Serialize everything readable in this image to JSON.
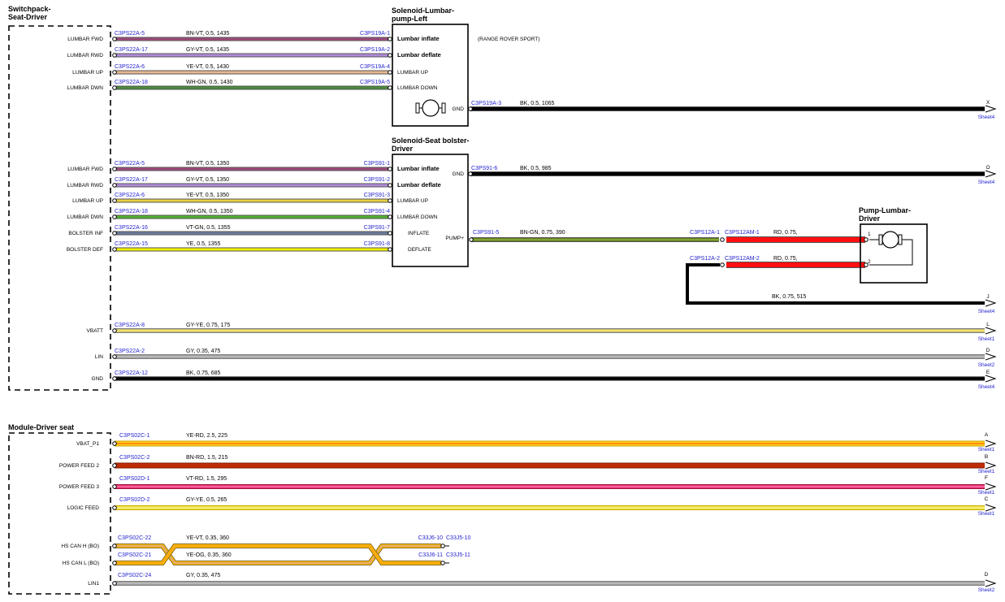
{
  "components": {
    "switchpack": {
      "title_line1": "Switchpack-",
      "title_line2": "Seat-Driver",
      "pins": [
        "LUMBAR FWD",
        "LUMBAR RWD",
        "LUMBAR UP",
        "LUMBAR DWN",
        "LUMBAR FWD",
        "LUMBAR RWD",
        "LUMBAR UP",
        "LUMBAR DWN",
        "BOLSTER INF",
        "BOLSTER DEF",
        "VBATT",
        "LIN",
        "GND"
      ]
    },
    "solenoid_lumbar": {
      "title_line1": "Solenoid-Lumbar-",
      "title_line2": "pump-Left",
      "pins": [
        "Lumbar inflate",
        "Lumbar deflate",
        "LUMBAR UP",
        "LUMBAR DOWN"
      ],
      "gnd": "GND",
      "note": "(RANGE ROVER SPORT)"
    },
    "solenoid_bolster": {
      "title_line1": "Solenoid-Seat bolster-",
      "title_line2": "Driver",
      "pins": [
        "Lumbar inflate",
        "Lumbar deflate",
        "LUMBAR UP",
        "LUMBAR DOWN",
        "INFLATE",
        "DEFLATE"
      ],
      "gnd": "GND",
      "pump": "PUMP+"
    },
    "pump": {
      "title_line1": "Pump-Lumbar-",
      "title_line2": "Driver",
      "pin1": "1",
      "pin2": "2"
    },
    "module": {
      "title": "Module-Driver seat",
      "pins": [
        "VBAT_P1",
        "POWER FEED 2",
        "POWER FEED 3",
        "LOGIC FEED",
        "HS CAN H (BO)",
        "HS CAN L (BO)",
        "LIN1"
      ]
    }
  },
  "wires": [
    {
      "from": "C3PS22A-5",
      "to": "C3PS19A-1",
      "label": "BN-VT,  0.5,  1435",
      "color": "#9c4a7a"
    },
    {
      "from": "C3PS22A-17",
      "to": "C3PS19A-2",
      "label": "GY-VT,  0.5,  1435",
      "color": "#b08ad8"
    },
    {
      "from": "C3PS22A-6",
      "to": "C3PS19A-4",
      "label": "YE-VT,  0.5,  1430",
      "color": "#e8b890"
    },
    {
      "from": "C3PS22A-18",
      "to": "C3PS19A-5",
      "label": "WH-GN,  0.5,  1430",
      "color": "#4a8a3a"
    },
    {
      "from": "C3PS22A-5",
      "to": "C3PS91-1",
      "label": "BN-VT,  0.5,  1350",
      "color": "#9c4a7a"
    },
    {
      "from": "C3PS22A-17",
      "to": "C3PS91-2",
      "label": "GY-VT,  0.5,  1350",
      "color": "#b08ad8"
    },
    {
      "from": "C3PS22A-6",
      "to": "C3PS91-3",
      "label": "YE-VT,  0.5,  1350",
      "color": "#e8d040"
    },
    {
      "from": "C3PS22A-18",
      "to": "C3PS91-4",
      "label": "WH-GN,  0.5,  1350",
      "color": "#50b030"
    },
    {
      "from": "C3PS22A-16",
      "to": "C3PS91-7",
      "label": "VT-GN,  0.5,  1355",
      "color": "#6a7a9a"
    },
    {
      "from": "C3PS22A-15",
      "to": "C3PS91-8",
      "label": "YE,  0.5,  1355",
      "color": "#f0f000"
    },
    {
      "from": "C3PS22A-8",
      "to": "",
      "label": "GY-YE,  0.75,  175",
      "color": "#eee070",
      "dest": "L",
      "sheet": "Sheet1"
    },
    {
      "from": "C3PS22A-2",
      "to": "",
      "label": "GY,  0.35,  475",
      "color": "#b8b8b8",
      "dest": "D",
      "sheet": "Sheet2"
    },
    {
      "from": "C3PS22A-12",
      "to": "",
      "label": "BK,  0.75,  685",
      "color": "#000000",
      "dest": "E",
      "sheet": "Sheet4"
    }
  ],
  "gnd_wires": [
    {
      "from": "C3PS19A-3",
      "label": "BK,  0.5,  1065",
      "dest": "X",
      "sheet": "Sheet4"
    },
    {
      "from": "C3PS91-6",
      "label": "BK,  0.5,  985",
      "dest": "O",
      "sheet": "Sheet4"
    }
  ],
  "pump_wires": {
    "pos_from": "C3PS91-5",
    "pos_label": "BN-GN,  0.75,  390",
    "c1a": "C3PS12A-1",
    "c1b": "C3PS12AM-1",
    "c1_label": "RD,  0.75,",
    "c2a": "C3PS12A-2",
    "c2b": "C3PS12AM-2",
    "c2_label": "RD,  0.75,",
    "gnd_label": "BK,  0.75,  515",
    "gnd_dest": "J",
    "gnd_sheet": "Sheet4"
  },
  "module_wires": [
    {
      "from": "C3PS02C-1",
      "label": "YE-RD,  2.5,  225",
      "dest": "A",
      "sheet": "Sheet1"
    },
    {
      "from": "C3PS02C-2",
      "label": "BN-RD,  1.5,  215",
      "dest": "B",
      "sheet": "Sheet1"
    },
    {
      "from": "C3PS02D-1",
      "label": "VT-RD,  1.5,  295",
      "dest": "F",
      "sheet": "Sheet1"
    },
    {
      "from": "C3PS02D-2",
      "label": "GY-YE,  0.5,  265",
      "dest": "C",
      "sheet": "Sheet1"
    }
  ],
  "can": {
    "h_from": "C3PS02C-22",
    "h_label": "YE-VT,  0.35,  360",
    "h_to1": "C33J6-10",
    "h_to2": "C33J5-10",
    "l_from": "C3PS02C-21",
    "l_label": "YE-OG,  0.35,  360",
    "l_to1": "C33J6-11",
    "l_to2": "C33J5-11"
  },
  "lin1": {
    "from": "C3PS02C-24",
    "label": "GY,  0.35,  475",
    "dest": "D",
    "sheet": "Sheet2"
  },
  "colors": {
    "connector": "#1f1fd0",
    "black": "#000000",
    "red": "#ff1010",
    "yellow": "#ffd21a",
    "brown_red": "#c82808",
    "magenta": "#e8306a"
  }
}
